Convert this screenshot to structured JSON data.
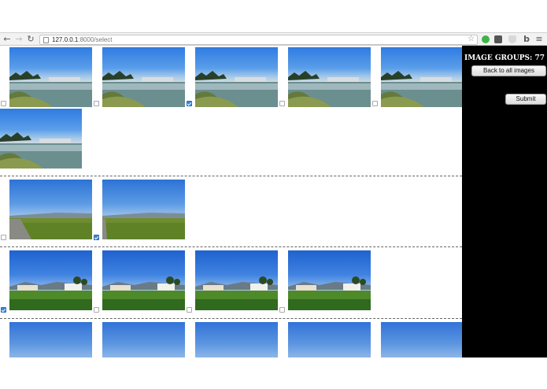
{
  "browser": {
    "url_host": "127.0.0.1",
    "url_path": ":8000/select",
    "icons": [
      "back-arrow-icon",
      "forward-arrow-icon",
      "reload-icon",
      "page-icon",
      "bookmark-star-icon",
      "evernote-extension-icon",
      "pocket-extension-icon",
      "shield-extension-icon",
      "bing-extension-icon",
      "menu-icon"
    ]
  },
  "sidebar": {
    "groups_label": "IMAGE GROUPS: 77",
    "back_button": "Back to all images",
    "submit_button": "Submit"
  },
  "colors": {
    "sidebar_bg": "#000000",
    "checkbox_checked": "#3a86d8",
    "divider": "#666666"
  },
  "groups": [
    {
      "scene": "marina",
      "images": [
        {
          "selected": false
        },
        {
          "selected": false
        },
        {
          "selected": true
        },
        {
          "selected": false
        },
        {
          "selected": false
        },
        {
          "selected": false
        }
      ]
    },
    {
      "scene": "field",
      "images": [
        {
          "selected": false
        },
        {
          "selected": true
        }
      ]
    },
    {
      "scene": "golden-gate",
      "images": [
        {
          "selected": true
        },
        {
          "selected": false
        },
        {
          "selected": false
        },
        {
          "selected": false
        }
      ]
    },
    {
      "scene": "sky",
      "images": [
        {
          "selected": false
        },
        {
          "selected": false
        },
        {
          "selected": false
        },
        {
          "selected": false
        },
        {
          "selected": false
        }
      ]
    }
  ]
}
